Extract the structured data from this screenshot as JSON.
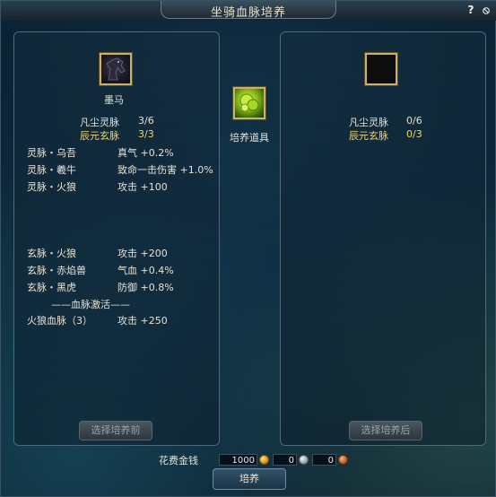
{
  "window": {
    "title": "坐骑血脉培养",
    "help_label": "?",
    "close_label": "⦸"
  },
  "left": {
    "mount_name": "墨马",
    "summary": [
      {
        "label": "凡尘灵脉",
        "value": "3/6",
        "color": "#e6e2d6"
      },
      {
        "label": "辰元玄脉",
        "value": "3/3",
        "color": "#f2d66a"
      }
    ],
    "ling_mai": [
      {
        "name": "灵脉・乌吾",
        "effect": "真气 +0.2%"
      },
      {
        "name": "灵脉・羲牛",
        "effect": "致命一击伤害 +1.0%"
      },
      {
        "name": "灵脉・火狼",
        "effect": "攻击 +100"
      }
    ],
    "xuan_mai": [
      {
        "name": "玄脉・火狼",
        "effect": "攻击 +200"
      },
      {
        "name": "玄脉・赤焰兽",
        "effect": "气血 +0.4%"
      },
      {
        "name": "玄脉・黑虎",
        "effect": "防御 +0.8%"
      }
    ],
    "activation_header": "——血脉激活——",
    "activation": {
      "name": "火狼血脉（3）",
      "effect": "攻击 +250"
    },
    "select_button": "选择培养前"
  },
  "middle": {
    "item_label": "培养道具"
  },
  "right": {
    "summary": [
      {
        "label": "凡尘灵脉",
        "value": "0/6",
        "color": "#e6e2d6"
      },
      {
        "label": "辰元玄脉",
        "value": "0/3",
        "color": "#f2d66a"
      }
    ],
    "select_button": "选择培养后"
  },
  "footer": {
    "cost_label": "花费金钱",
    "gold": "1000",
    "silver": "0",
    "copper": "0",
    "train_button": "培养"
  },
  "colors": {
    "gold_text": "#f2d66a",
    "slot_border": "#c9b36a"
  }
}
